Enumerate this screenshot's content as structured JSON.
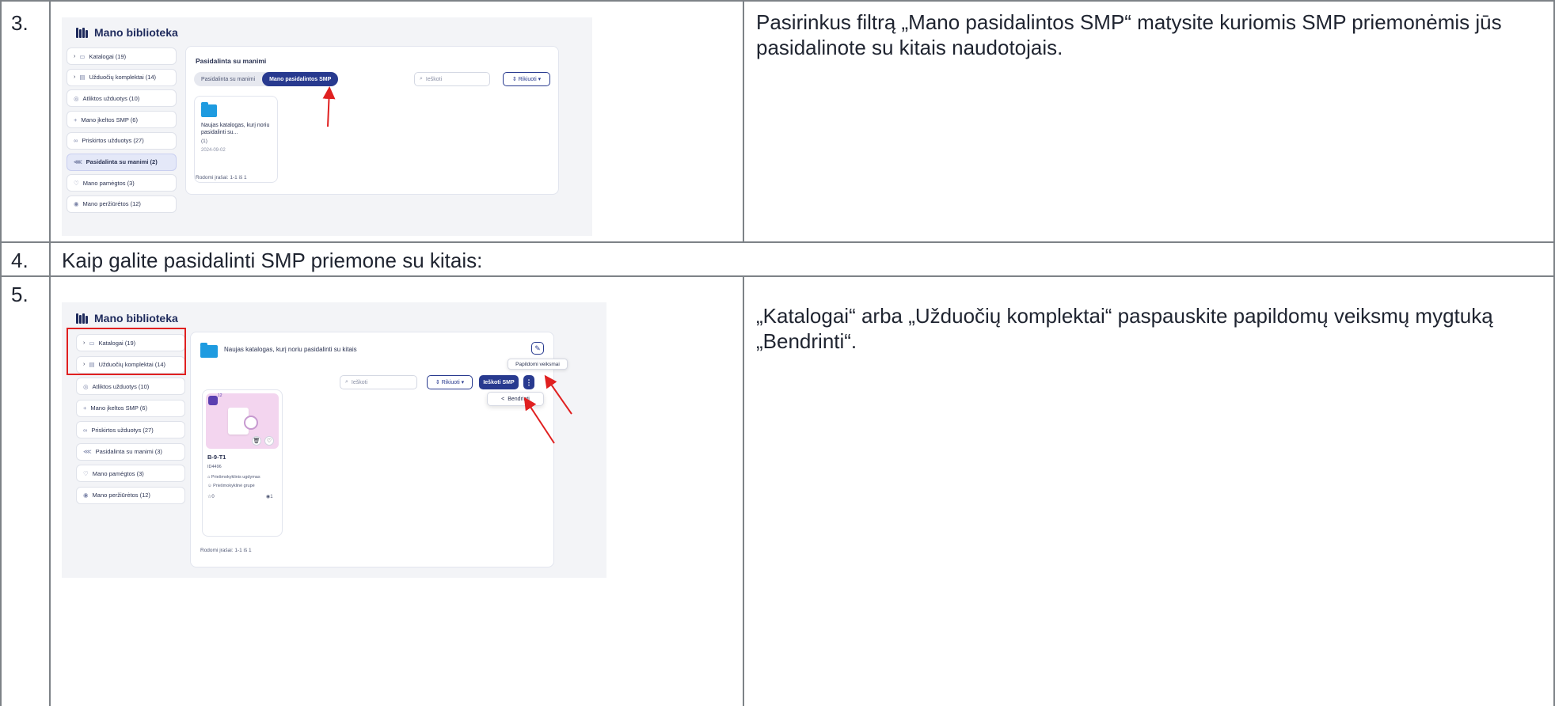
{
  "rows": [
    {
      "number": "3.",
      "description": "Pasirinkus filtrą „Mano pasidalintos SMP“ matysite kuriomis SMP priemonėmis jūs pasidalinote su  kitais naudotojais.",
      "screenshot": {
        "title": "Mano biblioteka",
        "sidebar": [
          {
            "label": "Katalogai (19)",
            "icon": "folder-outline-icon",
            "chevron": true,
            "active": false
          },
          {
            "label": "Užduočių komplektai (14)",
            "icon": "stack-icon",
            "chevron": true,
            "active": false
          },
          {
            "label": "Atliktos užduotys (10)",
            "icon": "check-circle-icon",
            "chevron": false,
            "active": false
          },
          {
            "label": "Mano įkeltos SMP (6)",
            "icon": "plus-icon",
            "chevron": false,
            "active": false
          },
          {
            "label": "Priskirtos užduotys (27)",
            "icon": "link-icon",
            "chevron": false,
            "active": false
          },
          {
            "label": "Pasidalinta su manimi (2)",
            "icon": "share-icon",
            "chevron": false,
            "active": true
          },
          {
            "label": "Mano pamėgtos (3)",
            "icon": "heart-icon",
            "chevron": false,
            "active": false
          },
          {
            "label": "Mano peržiūrėtos (12)",
            "icon": "eye-icon",
            "chevron": false,
            "active": false
          }
        ],
        "main_title": "Pasidalinta su manimi",
        "segments": [
          "Pasidalinta su manimi",
          "Mano pasidalintos SMP"
        ],
        "active_segment": 1,
        "search_placeholder": "Ieškoti",
        "sort_label": "Rikiuoti",
        "item": {
          "title": "Naujas katalogas, kurį noriu pasidalinti su...",
          "count": "(1)",
          "date": "2024-09-02"
        },
        "footer": "Rodomi įrašai: 1-1 iš 1"
      }
    },
    {
      "number": "4.",
      "description": "Kaip galite pasidalinti SMP priemone su kitais:"
    },
    {
      "number": "5.",
      "description": "„Katalogai“ arba „Užduočių komplektai“ paspauskite papildomų veiksmų mygtuką „Bendrinti“.",
      "screenshot": {
        "title": "Mano biblioteka",
        "sidebar": [
          {
            "label": "Katalogai (19)",
            "icon": "folder-outline-icon",
            "chevron": true
          },
          {
            "label": "Užduočių komplektai (14)",
            "icon": "stack-icon",
            "chevron": true
          },
          {
            "label": "Atliktos užduotys (10)",
            "icon": "check-circle-icon",
            "chevron": false
          },
          {
            "label": "Mano įkeltos SMP (6)",
            "icon": "plus-icon",
            "chevron": false
          },
          {
            "label": "Priskirtos užduotys (27)",
            "icon": "link-icon",
            "chevron": false
          },
          {
            "label": "Pasidalinta su manimi (3)",
            "icon": "share-icon",
            "chevron": false
          },
          {
            "label": "Mano pamėgtos (3)",
            "icon": "heart-icon",
            "chevron": false
          },
          {
            "label": "Mano peržiūrėtos (12)",
            "icon": "eye-icon",
            "chevron": false
          }
        ],
        "header_title": "Naujas katalogas, kurį noriu pasidalinti su kitais",
        "tooltip": "Papildomi veiksmai",
        "search_placeholder": "Ieškoti",
        "sort_label": "Rikiuoti",
        "primary_button": "Ieškoti SMP",
        "menu_item": "Bendrinti",
        "badge_count": "12",
        "item": {
          "title": "B-9-T1",
          "id": "ID4496",
          "tag1": "Priešmokyklinis ugdymas",
          "tag2": "Priešmokyklinė grupė",
          "stars": "0",
          "views": "1"
        },
        "footer": "Rodomi įrašai: 1-1 iš 1"
      }
    }
  ],
  "colors": {
    "grid": "#7d8287",
    "accent": "#283a8f",
    "arrow": "#e02020",
    "highlight": "#e02020"
  }
}
